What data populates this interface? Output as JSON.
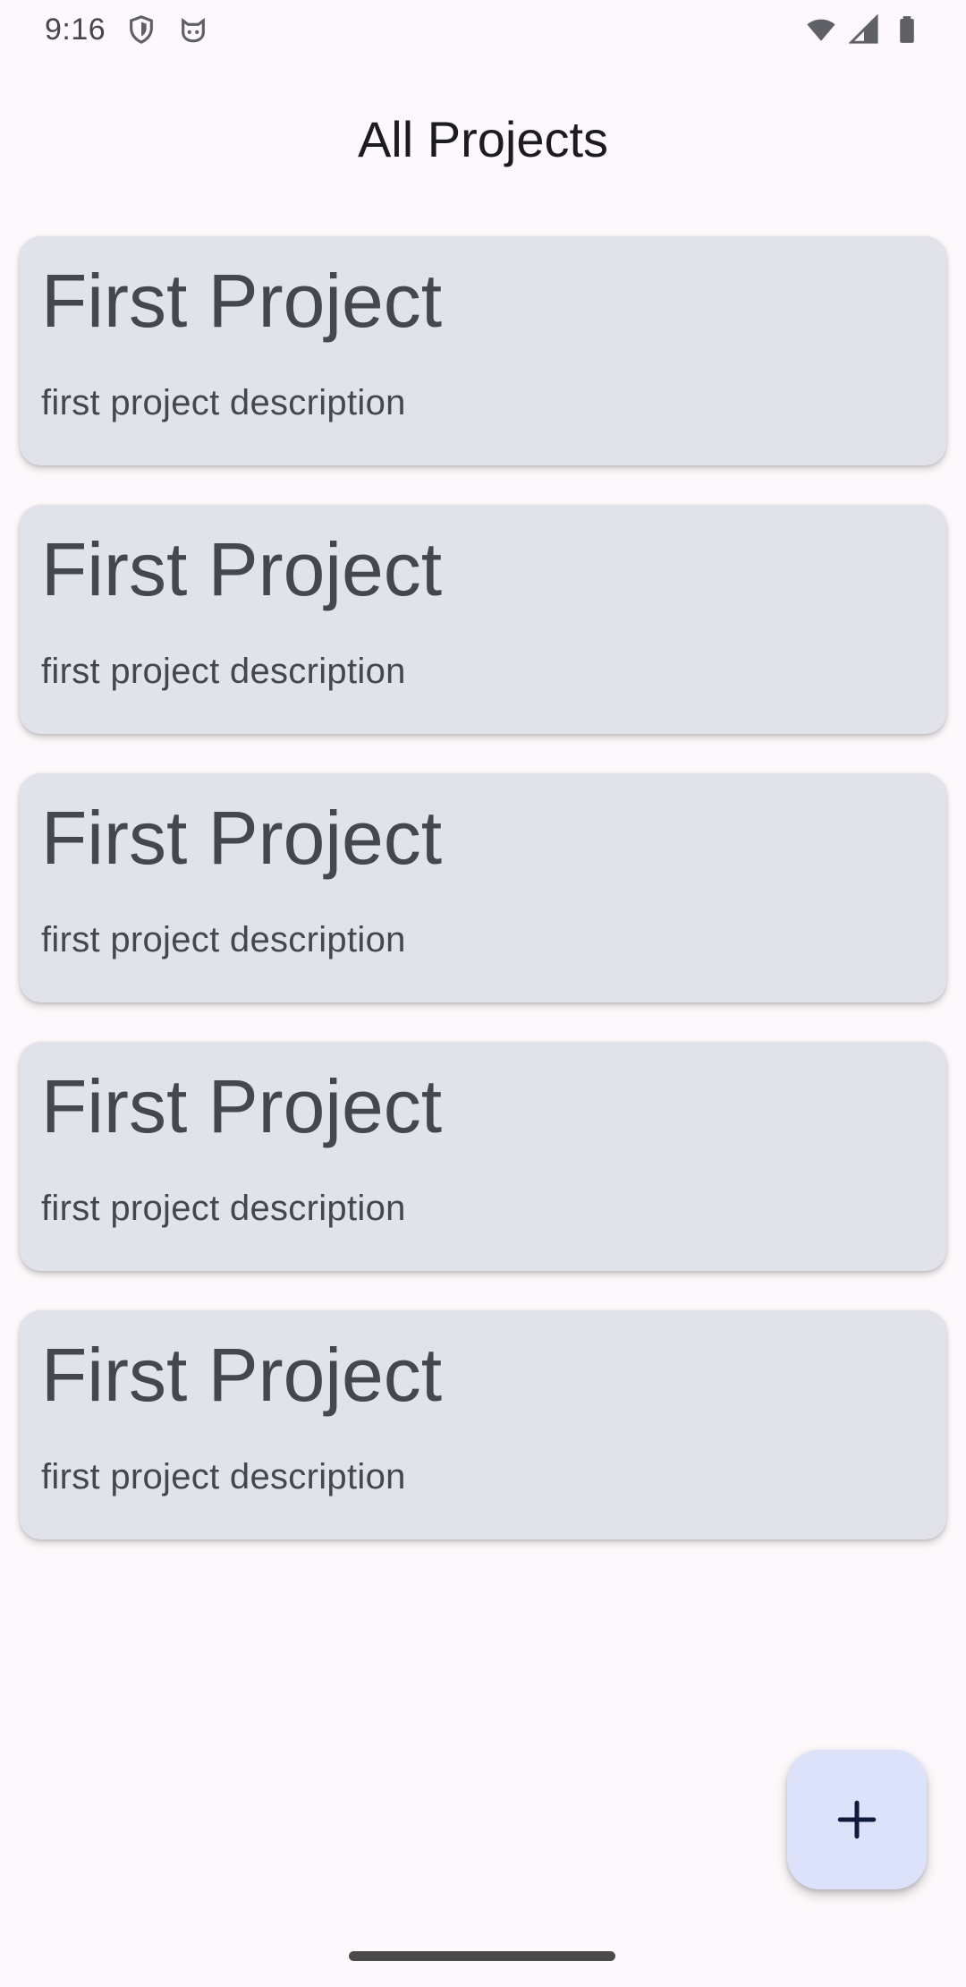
{
  "status_bar": {
    "time": "9:16",
    "left_icons": [
      "shield-icon",
      "cat-face-icon"
    ],
    "right_icons": [
      "wifi-icon",
      "cellular-signal-icon",
      "battery-icon"
    ]
  },
  "app_bar": {
    "title": "All Projects"
  },
  "projects": [
    {
      "title": "First Project",
      "description": "first project description"
    },
    {
      "title": "First Project",
      "description": "first project description"
    },
    {
      "title": "First Project",
      "description": "first project description"
    },
    {
      "title": "First Project",
      "description": "first project description"
    },
    {
      "title": "First Project",
      "description": "first project description"
    }
  ],
  "fab": {
    "icon": "plus-icon"
  },
  "colors": {
    "background": "#fcf8fb",
    "card": "#e2e2ea",
    "card_text": "#45464f",
    "fab_bg": "#dde2fb",
    "fab_icon": "#0f1a3d"
  }
}
